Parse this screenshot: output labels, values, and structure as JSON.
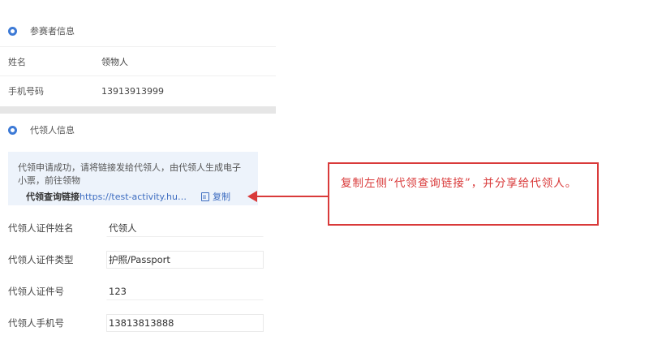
{
  "participant": {
    "section_title": "参赛者信息",
    "rows": [
      {
        "label": "姓名",
        "value": "领物人"
      },
      {
        "label": "手机号码",
        "value": "13913913999"
      }
    ]
  },
  "proxy": {
    "section_title": "代领人信息",
    "notice_text": "代领申请成功，请将链接发给代领人，由代领人生成电子小票，前往领物",
    "link_label": "代领查询链接",
    "link_url": "https://test-activity.huod...",
    "copy_label": "复制",
    "fields": [
      {
        "label": "代领人证件姓名",
        "value": "代领人"
      },
      {
        "label": "代领人证件类型",
        "value": "护照/Passport"
      },
      {
        "label": "代领人证件号",
        "value": "123"
      },
      {
        "label": "代领人手机号",
        "value": "13813813888"
      }
    ]
  },
  "annotation": {
    "text": "复制左侧“代领查询链接”，并分享给代领人。",
    "color": "#d93a3a"
  },
  "colors": {
    "accent": "#3d7ad6",
    "link": "#3d6cc0"
  }
}
